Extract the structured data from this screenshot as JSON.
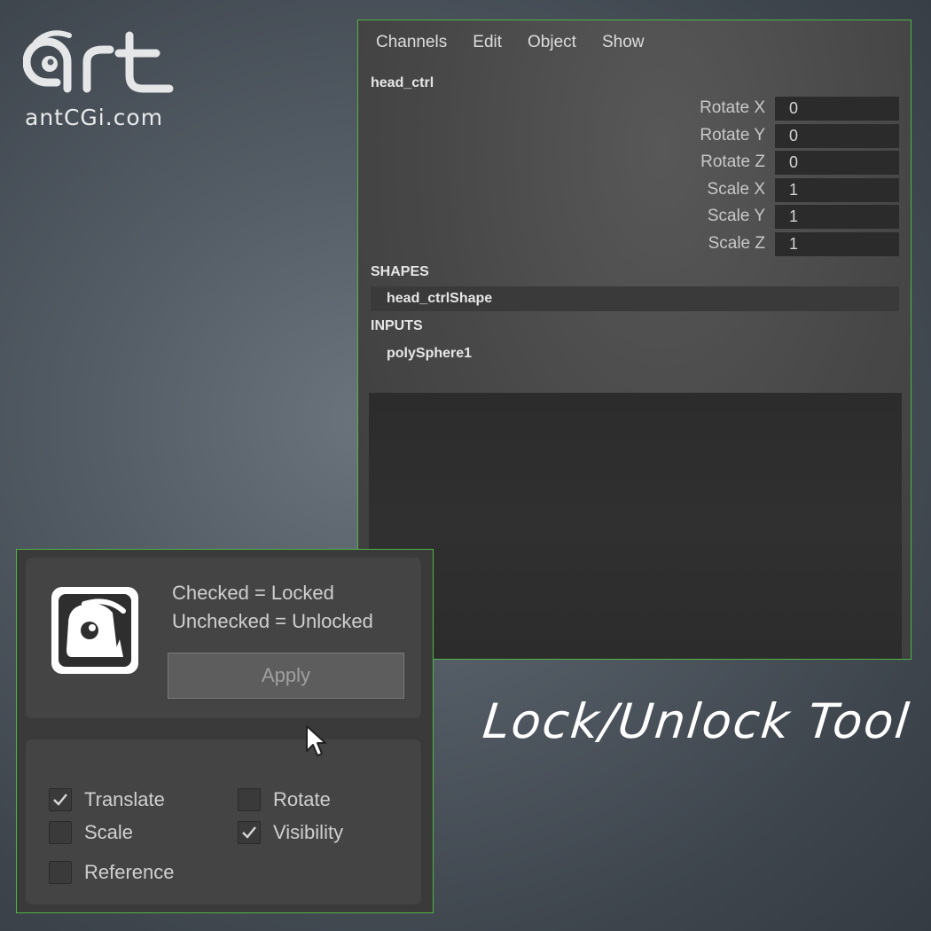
{
  "logo": {
    "brand": "Art",
    "url": "antCGi.com"
  },
  "channel_box": {
    "menu": [
      "Channels",
      "Edit",
      "Object",
      "Show"
    ],
    "node_name": "head_ctrl",
    "attributes": [
      {
        "label": "Rotate X",
        "value": "0"
      },
      {
        "label": "Rotate Y",
        "value": "0"
      },
      {
        "label": "Rotate Z",
        "value": "0"
      },
      {
        "label": "Scale X",
        "value": "1"
      },
      {
        "label": "Scale Y",
        "value": "1"
      },
      {
        "label": "Scale Z",
        "value": "1"
      }
    ],
    "shapes_header": "SHAPES",
    "shape_item": "head_ctrlShape",
    "inputs_header": "INPUTS",
    "input_item": "polySphere1"
  },
  "tool": {
    "legend_checked": "Checked = Locked",
    "legend_unchecked": "Unchecked = Unlocked",
    "apply_label": "Apply",
    "options": [
      {
        "label": "Translate",
        "checked": true
      },
      {
        "label": "Rotate",
        "checked": false
      },
      {
        "label": "Scale",
        "checked": false
      },
      {
        "label": "Visibility",
        "checked": true
      },
      {
        "label": "Reference",
        "checked": false
      }
    ]
  },
  "caption": "Lock/Unlock Tool",
  "colors": {
    "highlight_border": "#4fb545",
    "panel_bg": "#444444",
    "field_bg": "#2b2b2b"
  }
}
